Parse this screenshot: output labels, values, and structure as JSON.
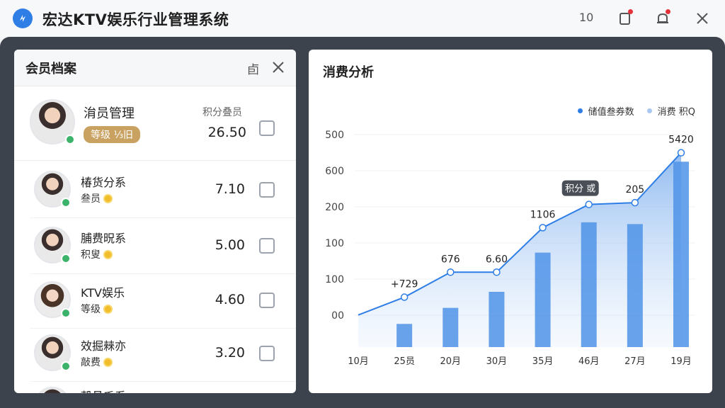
{
  "app": {
    "title": "宏达KTV娱乐行业管理系统",
    "count": "10"
  },
  "members_panel": {
    "title": "会员档案",
    "tool_text": "卣",
    "members": [
      {
        "name": "㳙员管理",
        "level_tag": "等级 ⅓旧",
        "label": "积分叠员",
        "value": "26.50"
      },
      {
        "name": "椿货分系",
        "sub": "叁员",
        "value": "7.10"
      },
      {
        "name": "脯费㫛系",
        "sub": "积叟",
        "value": "5.00"
      },
      {
        "name": "KTV娱乐",
        "sub": "等级",
        "value": "4.60"
      },
      {
        "name": "效掘㯤亦",
        "sub": "敲费",
        "value": "3.20"
      },
      {
        "name": "殸昌乑系",
        "sub": "",
        "value": ""
      }
    ]
  },
  "chart_panel": {
    "title": "消费分析"
  },
  "chart_data": {
    "type": "bar",
    "legend": [
      {
        "name": "储值叁券数",
        "color": "#2f7ee6"
      },
      {
        "name": "消费 积Q",
        "color": "#a9c8f2"
      }
    ],
    "y_ticks": [
      "500",
      "600",
      "200",
      "100",
      "100",
      "00"
    ],
    "categories": [
      "10月",
      "25员",
      "20月",
      "30月",
      "35月",
      "46月",
      "27月",
      "19月"
    ],
    "bar_values": [
      0,
      65,
      110,
      155,
      265,
      350,
      345,
      520
    ],
    "line_values": [
      90,
      140,
      210,
      210,
      335,
      400,
      405,
      545
    ],
    "point_labels": [
      "",
      "+729",
      "676",
      "6.60",
      "1106",
      "积分 或",
      "205",
      "5420"
    ],
    "legend_position": "top-right"
  }
}
